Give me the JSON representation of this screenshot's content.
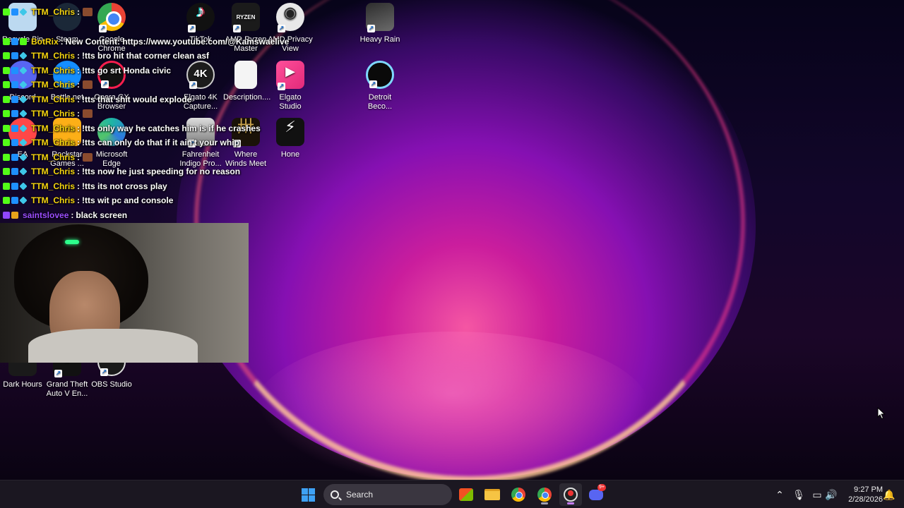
{
  "desktop": {
    "icons": [
      {
        "label": "Recycle Bin",
        "glyph": "recycle-bin-icon"
      },
      {
        "label": "Steam",
        "glyph": "steam-icon"
      },
      {
        "label": "Google Chrome",
        "glyph": "chrome-icon"
      },
      {
        "label": "TikTok",
        "glyph": "tiktok-icon"
      },
      {
        "label": "AMD Ryzen Master",
        "glyph": "ryzen-icon"
      },
      {
        "label": "AMD Privacy View",
        "glyph": "privacy-icon"
      },
      {
        "label": "Heavy Rain",
        "glyph": "heavy-rain-icon"
      },
      {
        "label": "Discord",
        "glyph": "discord-icon"
      },
      {
        "label": "Battle.net",
        "glyph": "battlenet-icon"
      },
      {
        "label": "Opera GX Browser",
        "glyph": "opera-gx-icon"
      },
      {
        "label": "Elgato 4K Capture...",
        "glyph": "elgato-4k-icon"
      },
      {
        "label": "Description....",
        "glyph": "document-icon"
      },
      {
        "label": "Elgato Studio",
        "glyph": "elgato-studio-icon"
      },
      {
        "label": "Detroit Beco...",
        "glyph": "detroit-icon"
      },
      {
        "label": "EA",
        "glyph": "ea-icon"
      },
      {
        "label": "Rockstar Games ...",
        "glyph": "rockstar-icon"
      },
      {
        "label": "Microsoft Edge",
        "glyph": "edge-icon"
      },
      {
        "label": "Fahrenheit Indigo Pro...",
        "glyph": "fahrenheit-icon"
      },
      {
        "label": "Where Winds Meet",
        "glyph": "where-winds-meet-icon"
      },
      {
        "label": "Hone",
        "glyph": "hone-icon"
      },
      {
        "label": "Dark Hours",
        "glyph": "dark-hours-icon"
      },
      {
        "label": "Grand Theft Auto V En...",
        "glyph": "gta-icon"
      },
      {
        "label": "OBS Studio",
        "glyph": "obs-icon"
      }
    ]
  },
  "chat": {
    "messages": [
      {
        "user": "TTM_Chris",
        "sep": ":",
        "text": ""
      },
      {
        "user": "BotRix",
        "sep": ":",
        "text": "New Content: https://www.youtube.com/@Kamswaelive"
      },
      {
        "user": "TTM_Chris",
        "sep": ":",
        "text": "!tts bro hit that corner clean asf"
      },
      {
        "user": "TTM_Chris",
        "sep": ":",
        "text": "!tts go srt Honda civic"
      },
      {
        "user": "TTM_Chris",
        "sep": ":",
        "text": ""
      },
      {
        "user": "TTM_Chris",
        "sep": ":",
        "text": "!tts that shit would explode"
      },
      {
        "user": "TTM_Chris",
        "sep": ":",
        "text": ""
      },
      {
        "user": "TTM_Chris",
        "sep": ":",
        "text": "!tts only way he catches him is if he crashes"
      },
      {
        "user": "TTM_Chris",
        "sep": ":",
        "text": "!tts can only do that if it ain't your whip"
      },
      {
        "user": "TTM_Chris",
        "sep": ":",
        "text": ""
      },
      {
        "user": "TTM_Chris",
        "sep": ":",
        "text": "!tts now he just speeding for no reason"
      },
      {
        "user": "TTM_Chris",
        "sep": ":",
        "text": "!tts its not cross play"
      },
      {
        "user": "TTM_Chris",
        "sep": ":",
        "text": "!tts wit pc and console"
      },
      {
        "user": "saintslovee",
        "sep": ":",
        "text": "black screen"
      }
    ]
  },
  "taskbar": {
    "search_placeholder": "Search",
    "discord_badge": "9+",
    "time": "9:27 PM",
    "date": "2/28/2026"
  },
  "colors": {
    "taskbar_bg": "#1c1822",
    "chat_username": "#f5d410",
    "chat_username_twitch": "#9b4dff",
    "kick_badge": "#53fc18"
  }
}
